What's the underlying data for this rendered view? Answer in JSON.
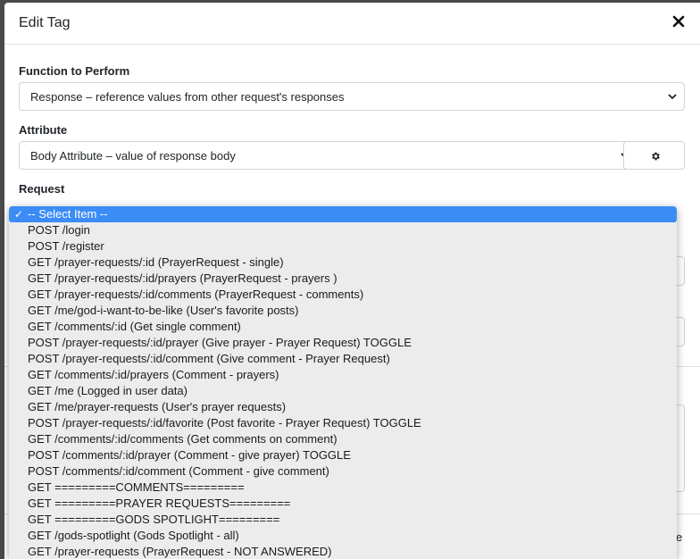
{
  "modal": {
    "title": "Edit Tag",
    "close_icon": "close-icon"
  },
  "function_field": {
    "label": "Function to Perform",
    "value": "Response – reference values from other request's responses"
  },
  "attribute_field": {
    "label": "Attribute",
    "value": "Body Attribute – value of response body",
    "settings_icon": "gear-icon"
  },
  "request_field": {
    "label": "Request",
    "selected": "-- Select Item --",
    "check_icon": "checkmark-icon",
    "options": [
      "-- Select Item --",
      "POST /login",
      "POST /register",
      "GET /prayer-requests/:id (PrayerRequest - single)",
      "GET /prayer-requests/:id/prayers (PrayerRequest - prayers )",
      "GET /prayer-requests/:id/comments (PrayerRequest - comments)",
      "GET /me/god-i-want-to-be-like (User's favorite posts)",
      "GET /comments/:id (Get single comment)",
      "POST /prayer-requests/:id/prayer (Give prayer - Prayer Request) TOGGLE",
      "POST /prayer-requests/:id/comment (Give comment - Prayer Request)",
      "GET /comments/:id/prayers (Comment - prayers)",
      "GET /me (Logged in user data)",
      "GET /me/prayer-requests (User's prayer requests)",
      "POST /prayer-requests/:id/favorite (Post favorite - Prayer Request) TOGGLE",
      "GET /comments/:id/comments (Get comments on comment)",
      "POST /comments/:id/prayer (Comment - give prayer) TOGGLE",
      "POST /comments/:id/comment (Comment - give comment)",
      "GET =========COMMENTS=========",
      "GET =========PRAYER REQUESTS=========",
      "GET =========GODS SPOTLIGHT=========",
      "GET /gods-spotlight (Gods Spotlight - all)",
      "GET /prayer-requests (PrayerRequest - NOT ANSWERED)"
    ]
  },
  "footer": {
    "partial_button_text": "e"
  },
  "colors": {
    "selected_bg": "#3c8cf5",
    "dropdown_bg": "#ececec",
    "border": "#ced4da"
  }
}
